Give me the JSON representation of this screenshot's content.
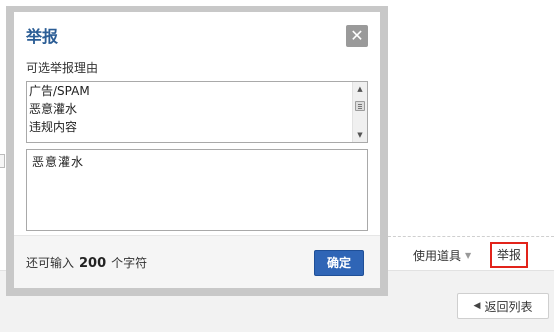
{
  "dialog": {
    "title": "举报",
    "close_glyph": "✕",
    "reason_label": "可选举报理由",
    "reasons": [
      "广告/SPAM",
      "恶意灌水",
      "违规内容"
    ],
    "reason_text_value": "恶意灌水",
    "counter_prefix": "还可输入",
    "counter_value": "200",
    "counter_suffix": "个字符",
    "confirm_label": "确定"
  },
  "page": {
    "tools_label": "使用道具",
    "tools_arrow": "▼",
    "report_label": "举报",
    "back_label": "返回列表",
    "back_arrow": "◀"
  }
}
